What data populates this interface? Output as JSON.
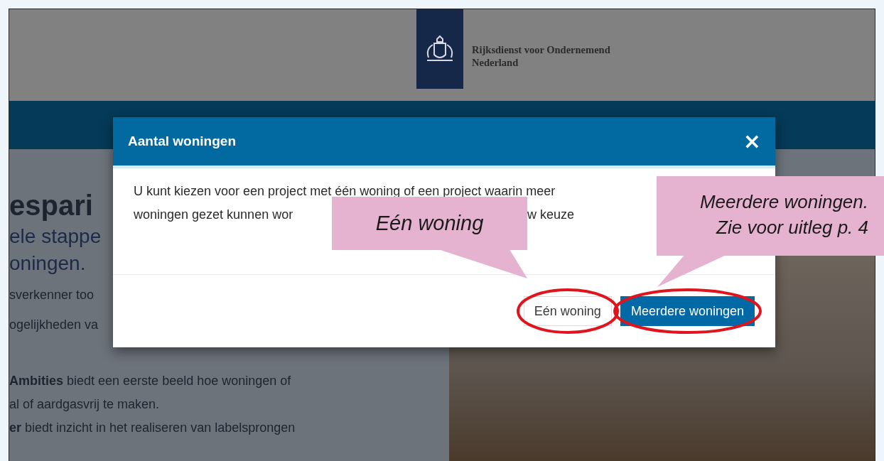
{
  "header": {
    "organization": [
      "Rijksdienst voor Ondernemend",
      "Nederland"
    ]
  },
  "page": {
    "heading": "espari",
    "subheading": [
      "ele stappe",
      "oningen."
    ],
    "intro": [
      "sverkenner too",
      "ogelijkheden va"
    ],
    "paragraphs": [
      "**Ambities** biedt een eerste beeld hoe woningen of",
      "al of aardgasvrij te maken.",
      "**er** biedt inzicht in het realiseren van labelsprongen"
    ]
  },
  "dialog": {
    "title": "Aantal woningen",
    "close": "×",
    "body_line_1": "U kunt kiezen voor een project met één woning of een project waarin meer",
    "body_line_2_parts": [
      "woningen gezet kunnen wor",
      "w keuze"
    ],
    "buttons": [
      {
        "label": "Eén woning",
        "kind": "secondary",
        "circled": true
      },
      {
        "label": "Meerdere woningen",
        "kind": "primary",
        "circled": true
      }
    ]
  },
  "annotations": [
    {
      "lines": [
        "Eén woning"
      ]
    },
    {
      "lines": [
        "Meerdere woningen.",
        "Zie voor uitleg p. 4"
      ]
    }
  ]
}
